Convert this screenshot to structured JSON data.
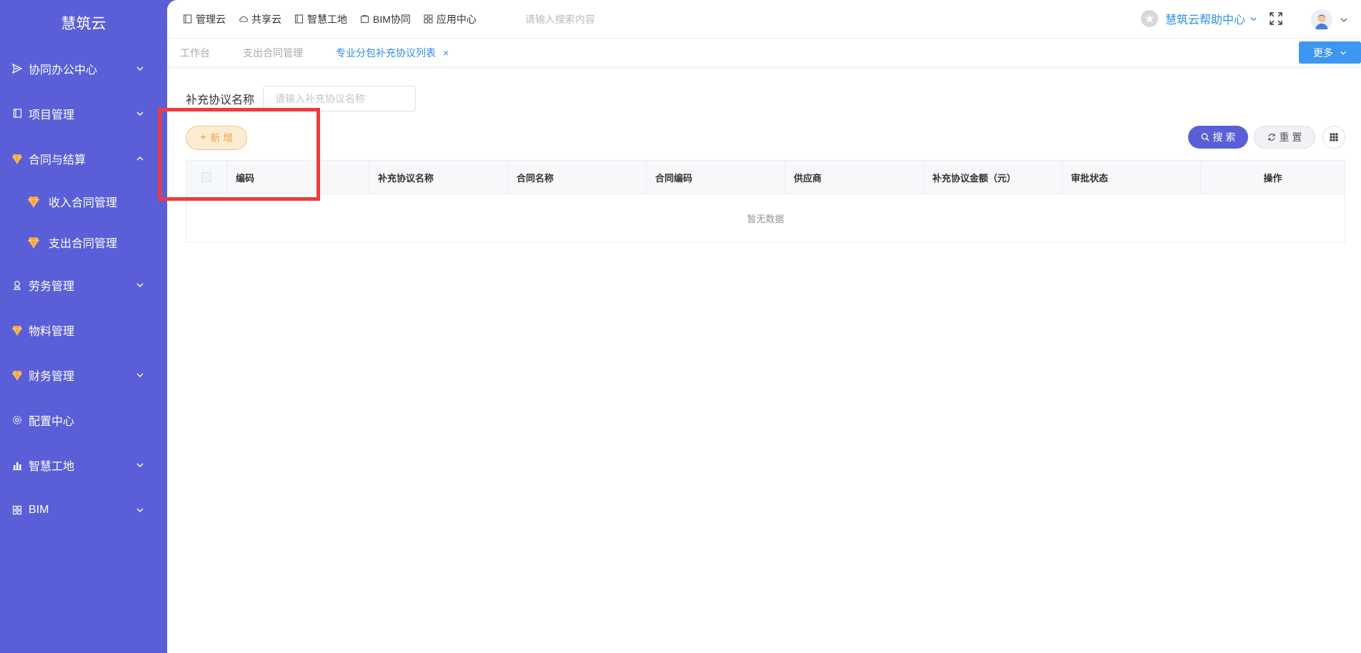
{
  "app": {
    "title": "慧筑云"
  },
  "sidebar": {
    "items": [
      {
        "label": "协同办公中心",
        "icon": "send-icon",
        "expanded": false
      },
      {
        "label": "项目管理",
        "icon": "book-icon",
        "expanded": false
      },
      {
        "label": "合同与结算",
        "icon": "gem-icon",
        "expanded": true,
        "children": [
          {
            "label": "收入合同管理",
            "icon": "gem-icon"
          },
          {
            "label": "支出合同管理",
            "icon": "gem-icon"
          }
        ]
      },
      {
        "label": "劳务管理",
        "icon": "worker-icon",
        "expanded": false
      },
      {
        "label": "物料管理",
        "icon": "gem-icon"
      },
      {
        "label": "财务管理",
        "icon": "gem-icon",
        "expanded": false
      },
      {
        "label": "配置中心",
        "icon": "gear-icon"
      },
      {
        "label": "智慧工地",
        "icon": "bar-chart-icon",
        "expanded": false
      },
      {
        "label": "BIM",
        "icon": "grid-icon",
        "expanded": false
      }
    ]
  },
  "topbar": {
    "nav": [
      {
        "label": "管理云",
        "icon": "book-icon"
      },
      {
        "label": "共享云",
        "icon": "cloud-icon"
      },
      {
        "label": "智慧工地",
        "icon": "book-icon"
      },
      {
        "label": "BIM协同",
        "icon": "box-icon"
      },
      {
        "label": "应用中心",
        "icon": "apps-icon"
      }
    ],
    "search_placeholder": "请输入搜索内容",
    "help_label": "慧筑云帮助中心"
  },
  "tabs": {
    "items": [
      {
        "label": "工作台",
        "active": false
      },
      {
        "label": "支出合同管理",
        "active": false
      },
      {
        "label": "专业分包补充协议列表",
        "active": true,
        "close": "×"
      }
    ],
    "more_label": "更多"
  },
  "filter": {
    "label": "补充协议名称",
    "placeholder": "请输入补充协议名称",
    "value": ""
  },
  "actions": {
    "add_label": "新 增",
    "search_label": "搜 索",
    "reset_label": "重 置"
  },
  "table": {
    "columns": [
      "编码",
      "补充协议名称",
      "合同名称",
      "合同编码",
      "供应商",
      "补充协议金额（元）",
      "审批状态",
      "操作"
    ],
    "rows": [],
    "empty_text": "暂无数据"
  },
  "colors": {
    "sidebar_bg": "#5a5fd8",
    "accent": "#2d8cf0",
    "add_button": "#f3a43a",
    "highlight": "#ee3b3b"
  }
}
